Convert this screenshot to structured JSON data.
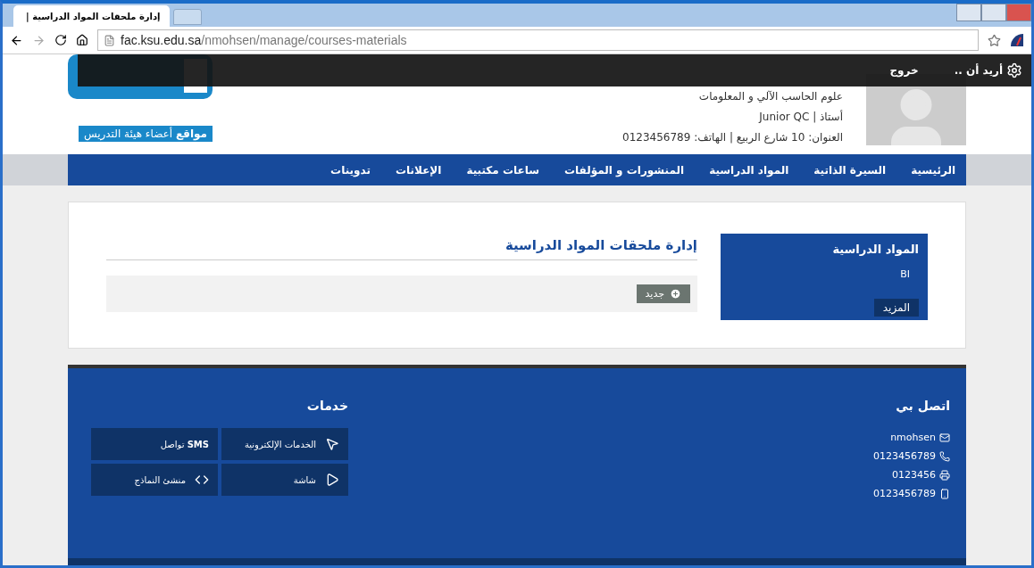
{
  "browser": {
    "tab_title": "إدارة ملحقات المواد الدراسية |",
    "url_host": "fac.ksu.edu.sa",
    "url_path": "/nmohsen/manage/courses-materials"
  },
  "top_bar": {
    "menu": "أريد أن ..",
    "logout": "خروج"
  },
  "header": {
    "sites_label": "**مواقع** أعضاء هيئة التدريس",
    "department": "علوم الحاسب الآلي و المعلومات",
    "title": "أستاذ | Junior QC",
    "address": "العنوان: 10 شارع الربيع | الهاتف: 0123456789"
  },
  "nav": [
    {
      "label": "الرئيسية",
      "selected": false
    },
    {
      "label": "السيرة الذاتية",
      "selected": false
    },
    {
      "label": "المواد الدراسية",
      "selected": false
    },
    {
      "label": "المنشورات و المؤلفات",
      "selected": false
    },
    {
      "label": "ساعات مكتبية",
      "selected": false
    },
    {
      "label": "الإعلانات",
      "selected": false
    },
    {
      "label": "تدوينات",
      "selected": false
    }
  ],
  "sidebar": {
    "title": "المواد الدراسية",
    "items": [
      "BI"
    ],
    "more": "المزيد"
  },
  "main": {
    "title": "إدارة ملحقات المواد الدراسية",
    "new_button": "جديد"
  },
  "footer": {
    "contact_title": "اتصل بي",
    "contacts": [
      {
        "kind": "email",
        "text": "nmohsen"
      },
      {
        "kind": "phone",
        "text": "0123456789"
      },
      {
        "kind": "fax",
        "text": "0123456"
      },
      {
        "kind": "mobile",
        "text": "0123456789"
      }
    ],
    "services_title": "خدمات",
    "services": [
      {
        "kind": "cursor",
        "label": "الخدمات الإلكترونية"
      },
      {
        "kind": "sms",
        "label": "**SMS** تواصل"
      },
      {
        "kind": "play",
        "label": "شاشة"
      },
      {
        "kind": "code",
        "label": "منشئ النماذج"
      }
    ]
  }
}
